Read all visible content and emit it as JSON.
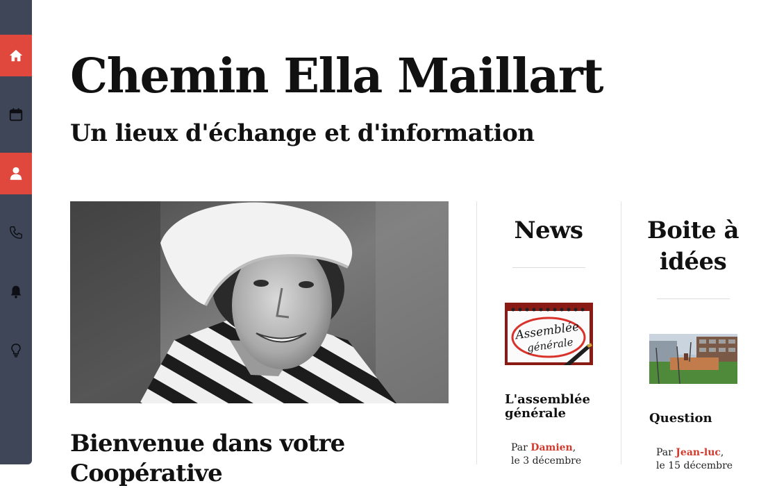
{
  "header": {
    "title": "Chemin Ella Maillart",
    "subtitle": "Un lieux d'échange et d'information"
  },
  "sidebar": {
    "items": [
      {
        "icon": "home-icon",
        "active": true
      },
      {
        "icon": "calendar-icon",
        "active": false
      },
      {
        "icon": "user-icon",
        "active": true
      },
      {
        "icon": "phone-icon",
        "active": false
      },
      {
        "icon": "bell-icon",
        "active": false
      },
      {
        "icon": "lightbulb-icon",
        "active": false
      }
    ]
  },
  "main": {
    "welcome_title": "Bienvenue dans votre Coopérative"
  },
  "news": {
    "title": "News",
    "post": {
      "image_text_line1": "Assemblée",
      "image_text_line2": "générale",
      "title": "L'assemblée générale",
      "by": "Par",
      "author": "Damien",
      "date": "le 3 décembre"
    }
  },
  "ideas": {
    "title": "Boite à idées",
    "post": {
      "title": "Question",
      "by": "Par",
      "author": "Jean-luc",
      "date": "le 15 décembre"
    }
  },
  "colors": {
    "sidebar": "#3f4658",
    "accent": "#e0483e",
    "author_link": "#d23a2e"
  }
}
